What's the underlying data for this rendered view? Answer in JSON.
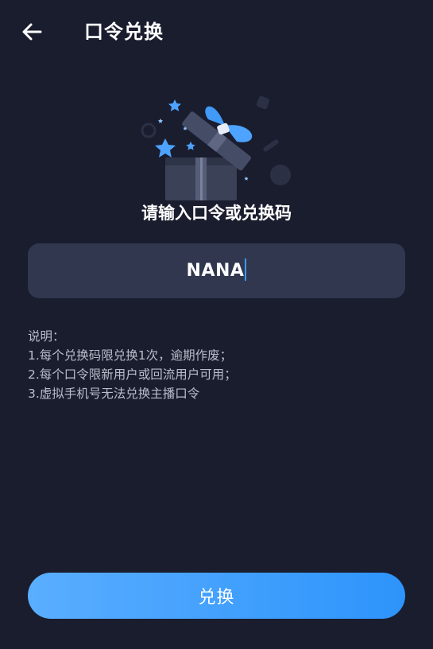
{
  "header": {
    "title": "口令兑换",
    "back_icon": "back-arrow-icon"
  },
  "illustration": {
    "icon": "gift-box-icon",
    "accent_color": "#4da3ff"
  },
  "prompt": {
    "label": "请输入口令或兑换码"
  },
  "code_input": {
    "value": "NANA"
  },
  "notes": {
    "heading": "说明：",
    "items": [
      "1.每个兑换码限兑换1次，逾期作废；",
      "2.每个口令限新用户或回流用户可用；",
      "3.虚拟手机号无法兑换主播口令"
    ]
  },
  "submit": {
    "label": "兑换",
    "color": "#3a9cfc"
  },
  "colors": {
    "background": "#1a1d2e",
    "input_background": "#30374f",
    "note_text": "#b9bdcb"
  }
}
